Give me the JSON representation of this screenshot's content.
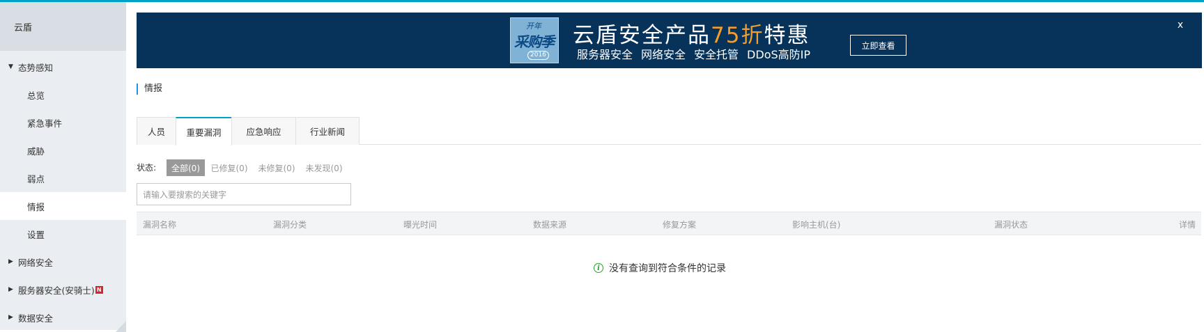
{
  "sidebar": {
    "title": "云盾",
    "groups": [
      {
        "label": "态势感知"
      },
      {
        "label": "网络安全"
      },
      {
        "label": "服务器安全(安骑士)",
        "badge": "N"
      },
      {
        "label": "数据安全"
      }
    ],
    "subitems": [
      "总览",
      "紧急事件",
      "威胁",
      "弱点",
      "情报",
      "设置"
    ],
    "active_item": "情报"
  },
  "banner": {
    "image_text": {
      "line1": "开年",
      "line2": "采购季",
      "year": "2016"
    },
    "headline_prefix": "云盾安全产品",
    "headline_highlight": "75折",
    "headline_suffix": "特惠",
    "subtitle_items": [
      "服务器安全",
      "网络安全",
      "安全托管",
      "DDoS高防IP"
    ],
    "button_label": "立即查看",
    "close_label": "x",
    "highlight_color": "#f39d2a",
    "background_color": "#07335b"
  },
  "section_title": "情报",
  "tabs": [
    {
      "label": "人员"
    },
    {
      "label": "重要漏洞",
      "active": true
    },
    {
      "label": "应急响应"
    },
    {
      "label": "行业新闻"
    }
  ],
  "status_filter": {
    "label": "状态:",
    "options": [
      "全部(0)",
      "已修复(0)",
      "未修复(0)",
      "未发现(0)"
    ],
    "selected": "全部(0)"
  },
  "search": {
    "placeholder": "请输入要搜索的关键字",
    "value": ""
  },
  "table": {
    "columns": [
      "漏洞名称",
      "漏洞分类",
      "曝光时间",
      "数据来源",
      "修复方案",
      "影响主机(台)",
      "漏洞状态",
      "详情"
    ],
    "rows": []
  },
  "empty_message": "没有查询到符合条件的记录",
  "colors": {
    "accent": "#00a2ca",
    "info_icon": "#2ca12c",
    "badge": "#d9232f"
  }
}
